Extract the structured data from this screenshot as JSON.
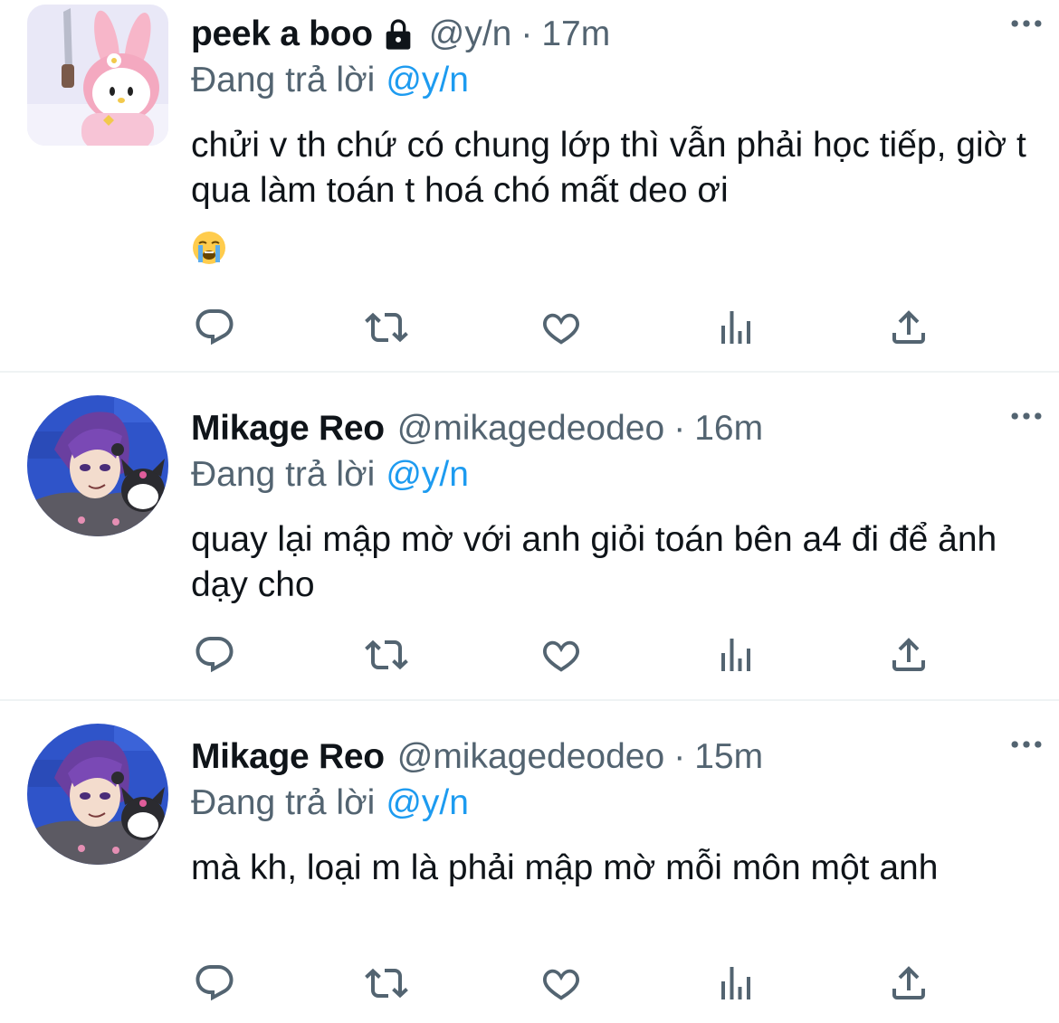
{
  "colors": {
    "accent": "#1d9bf0",
    "secondary_text": "#536471",
    "text": "#0f1419",
    "divider": "#eff3f4"
  },
  "tweets": [
    {
      "name": "peek a boo",
      "has_lock": true,
      "handle": "@y/n",
      "separator": "·",
      "time": "17m",
      "reply_prefix": "Đang trả lời",
      "reply_to": "@y/n",
      "text": "chửi v th chứ có chung lớp thì vẫn phải học tiếp, giờ t qua làm toán t hoá chó mất deo ơi",
      "emoji": "loudly-crying-face",
      "avatar": "pink-bunny-character-with-knife"
    },
    {
      "name": "Mikage Reo",
      "has_lock": false,
      "handle": "@mikagedeodeo",
      "separator": "·",
      "time": "16m",
      "reply_prefix": "Đang trả lời",
      "reply_to": "@y/n",
      "text": "quay lại mập mờ với anh giỏi toán bên a4 đi để ảnh dạy cho",
      "avatar": "purple-haired-anime-boy-with-kuromi"
    },
    {
      "name": "Mikage Reo",
      "has_lock": false,
      "handle": "@mikagedeodeo",
      "separator": "·",
      "time": "15m",
      "reply_prefix": "Đang trả lời",
      "reply_to": "@y/n",
      "text": "mà kh, loại m là phải mập mờ mỗi môn một anh",
      "avatar": "purple-haired-anime-boy-with-kuromi"
    }
  ],
  "icons": {
    "more": "more-horizontal-icon",
    "reply": "reply-icon",
    "retweet": "retweet-icon",
    "like": "like-icon",
    "views": "views-icon",
    "share": "share-icon",
    "lock": "lock-icon"
  }
}
